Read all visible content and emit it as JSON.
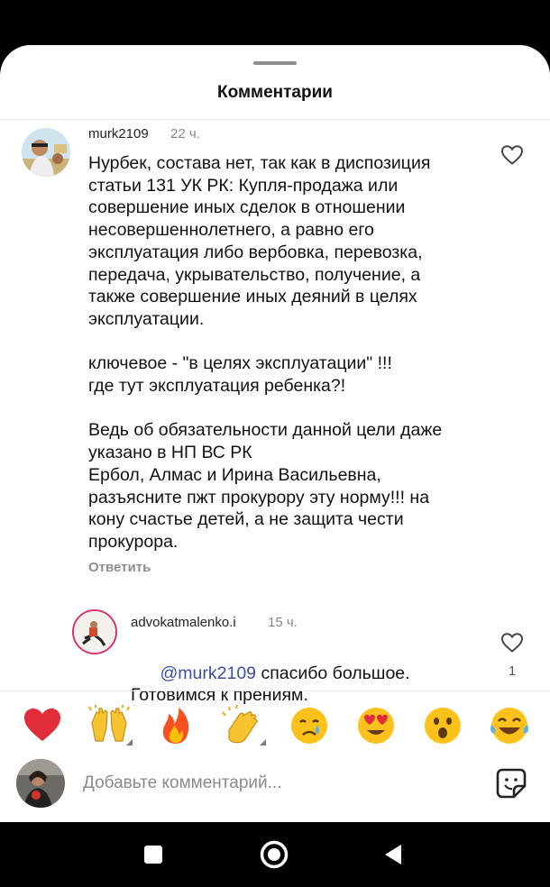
{
  "sheet": {
    "title": "Комментарии"
  },
  "comments": [
    {
      "username": "murk2109",
      "time": "22 ч.",
      "text": "Нурбек, состава нет, так как в диспозиция\nстатьи 131 УК РК: Купля-продажа или\nсовершение иных сделок в отношении\nнесовершеннолетнего, а равно его\nэксплуатация либо вербовка, перевозка,\nпередача, укрывательство, получение, а\nтакже совершение иных деяний в целях\nэксплуатации.\n\nключевое - \"в целях эксплуатации\" !!!\nгде тут эксплуатация ребенка?!\n\nВедь об обязательности данной цели даже\nуказано в НП ВС РК\nЕрбол, Алмас и Ирина Васильевна,\nразъясните пжт прокурору эту норму!!! на\nкону счастье детей, а не защита чести\nпрокурора.",
      "reply_label": "Ответить",
      "like_icon": "heart-outline-icon"
    }
  ],
  "replies": [
    {
      "username": "advokatmalenko.i",
      "time": "15 ч.",
      "mention": "@murk2109",
      "text_line1": " спасибо большое.",
      "text_line2": "Готовимся к прениям.",
      "like_count": "1",
      "like_icon": "heart-outline-icon"
    }
  ],
  "reactions": [
    {
      "icon": "red-heart-emoji"
    },
    {
      "icon": "raising-hands-emoji"
    },
    {
      "icon": "fire-emoji"
    },
    {
      "icon": "clapping-hands-emoji"
    },
    {
      "icon": "crying-face-emoji"
    },
    {
      "icon": "heart-eyes-emoji"
    },
    {
      "icon": "astonished-face-emoji"
    },
    {
      "icon": "tears-of-joy-emoji"
    }
  ],
  "composer": {
    "placeholder": "Добавьте комментарий...",
    "sticker_icon": "sticker-icon"
  },
  "navbar": {
    "buttons": [
      "recents-square-icon",
      "home-circle-icon",
      "back-triangle-icon"
    ]
  },
  "colors": {
    "mention": "#3a4fa3",
    "muted": "#8e8e8e",
    "background": "#ffffff"
  }
}
